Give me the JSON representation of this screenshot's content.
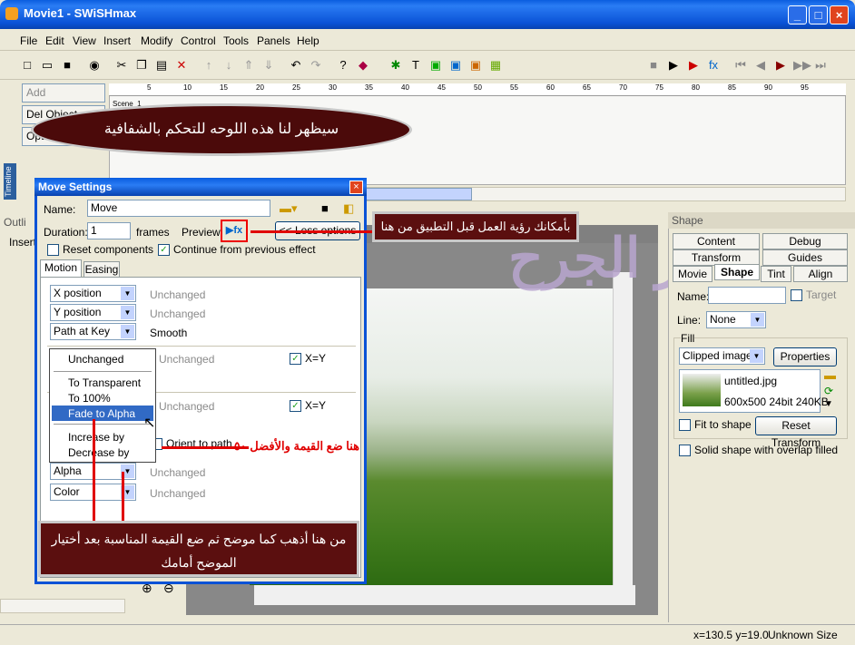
{
  "window": {
    "title": "Movie1 - SWiSHmax",
    "min": "_",
    "max": "□",
    "close": "×"
  },
  "menu": [
    "File",
    "Edit",
    "View",
    "Insert",
    "Modify",
    "Control",
    "Tools",
    "Panels",
    "Help"
  ],
  "timeline": {
    "add": "Add",
    "del": "Del Object",
    "options": "Options",
    "label": "Timeline",
    "scene": "Scene_1",
    "ruler": [
      "5",
      "10",
      "15",
      "20",
      "25",
      "30",
      "35",
      "40",
      "45",
      "50",
      "55",
      "60",
      "65",
      "70",
      "75",
      "80",
      "85",
      "90",
      "95"
    ]
  },
  "left": {
    "outline": "Outli",
    "insert": "Insert"
  },
  "dialog": {
    "title": "Move Settings",
    "name_label": "Name:",
    "name_value": "Move",
    "duration_label": "Duration:",
    "duration_value": "1",
    "frames": "frames",
    "preview": "Preview:",
    "less": "<< Less options",
    "reset": "Reset components",
    "continue": "Continue from previous effect",
    "tab_motion": "Motion",
    "tab_easing": "Easing",
    "xpos": "X position",
    "ypos": "Y position",
    "path": "Path at Key",
    "unchanged": "Unchanged",
    "smooth": "Smooth",
    "xy": "X=Y",
    "orient": "Orient to path",
    "alpha": "Alpha",
    "color": "Color"
  },
  "dropdown": [
    "Unchanged",
    "To Transparent",
    "To 100%",
    "Fade to Alpha",
    "Increase by",
    "Decrease by"
  ],
  "shape_panel": {
    "head": "Shape",
    "tabs": [
      "Content",
      "Debug",
      "Transform",
      "Guides",
      "Movie",
      "Shape",
      "Tint",
      "Align"
    ],
    "name": "Name:",
    "target": "Target",
    "line": "Line:",
    "line_value": "None",
    "fill": "Fill",
    "fill_type": "Clipped image",
    "properties": "Properties",
    "file": "untitled.jpg",
    "file_info": "600x500 24bit 240KB",
    "fit": "Fit to shape",
    "reset_transform": "Reset Transform",
    "solid": "Solid shape with overlap filled"
  },
  "callouts": {
    "top": "سيظهر لنا هذه اللوحه للتحكم بالشفافية",
    "preview": "بأمكانك رؤية العمل قبل التطبيق من هنا",
    "value": "هنا ضع القيمة والأفضل ٥٠",
    "bottom": "من هنا أذهب كما موضح ثم ضع القيمة المناسبة بعد أختيار الموضح أمامك"
  },
  "watermark": "أسير الجرح",
  "status": {
    "coords": "x=130.5 y=19.0",
    "size": "Unknown Size"
  }
}
